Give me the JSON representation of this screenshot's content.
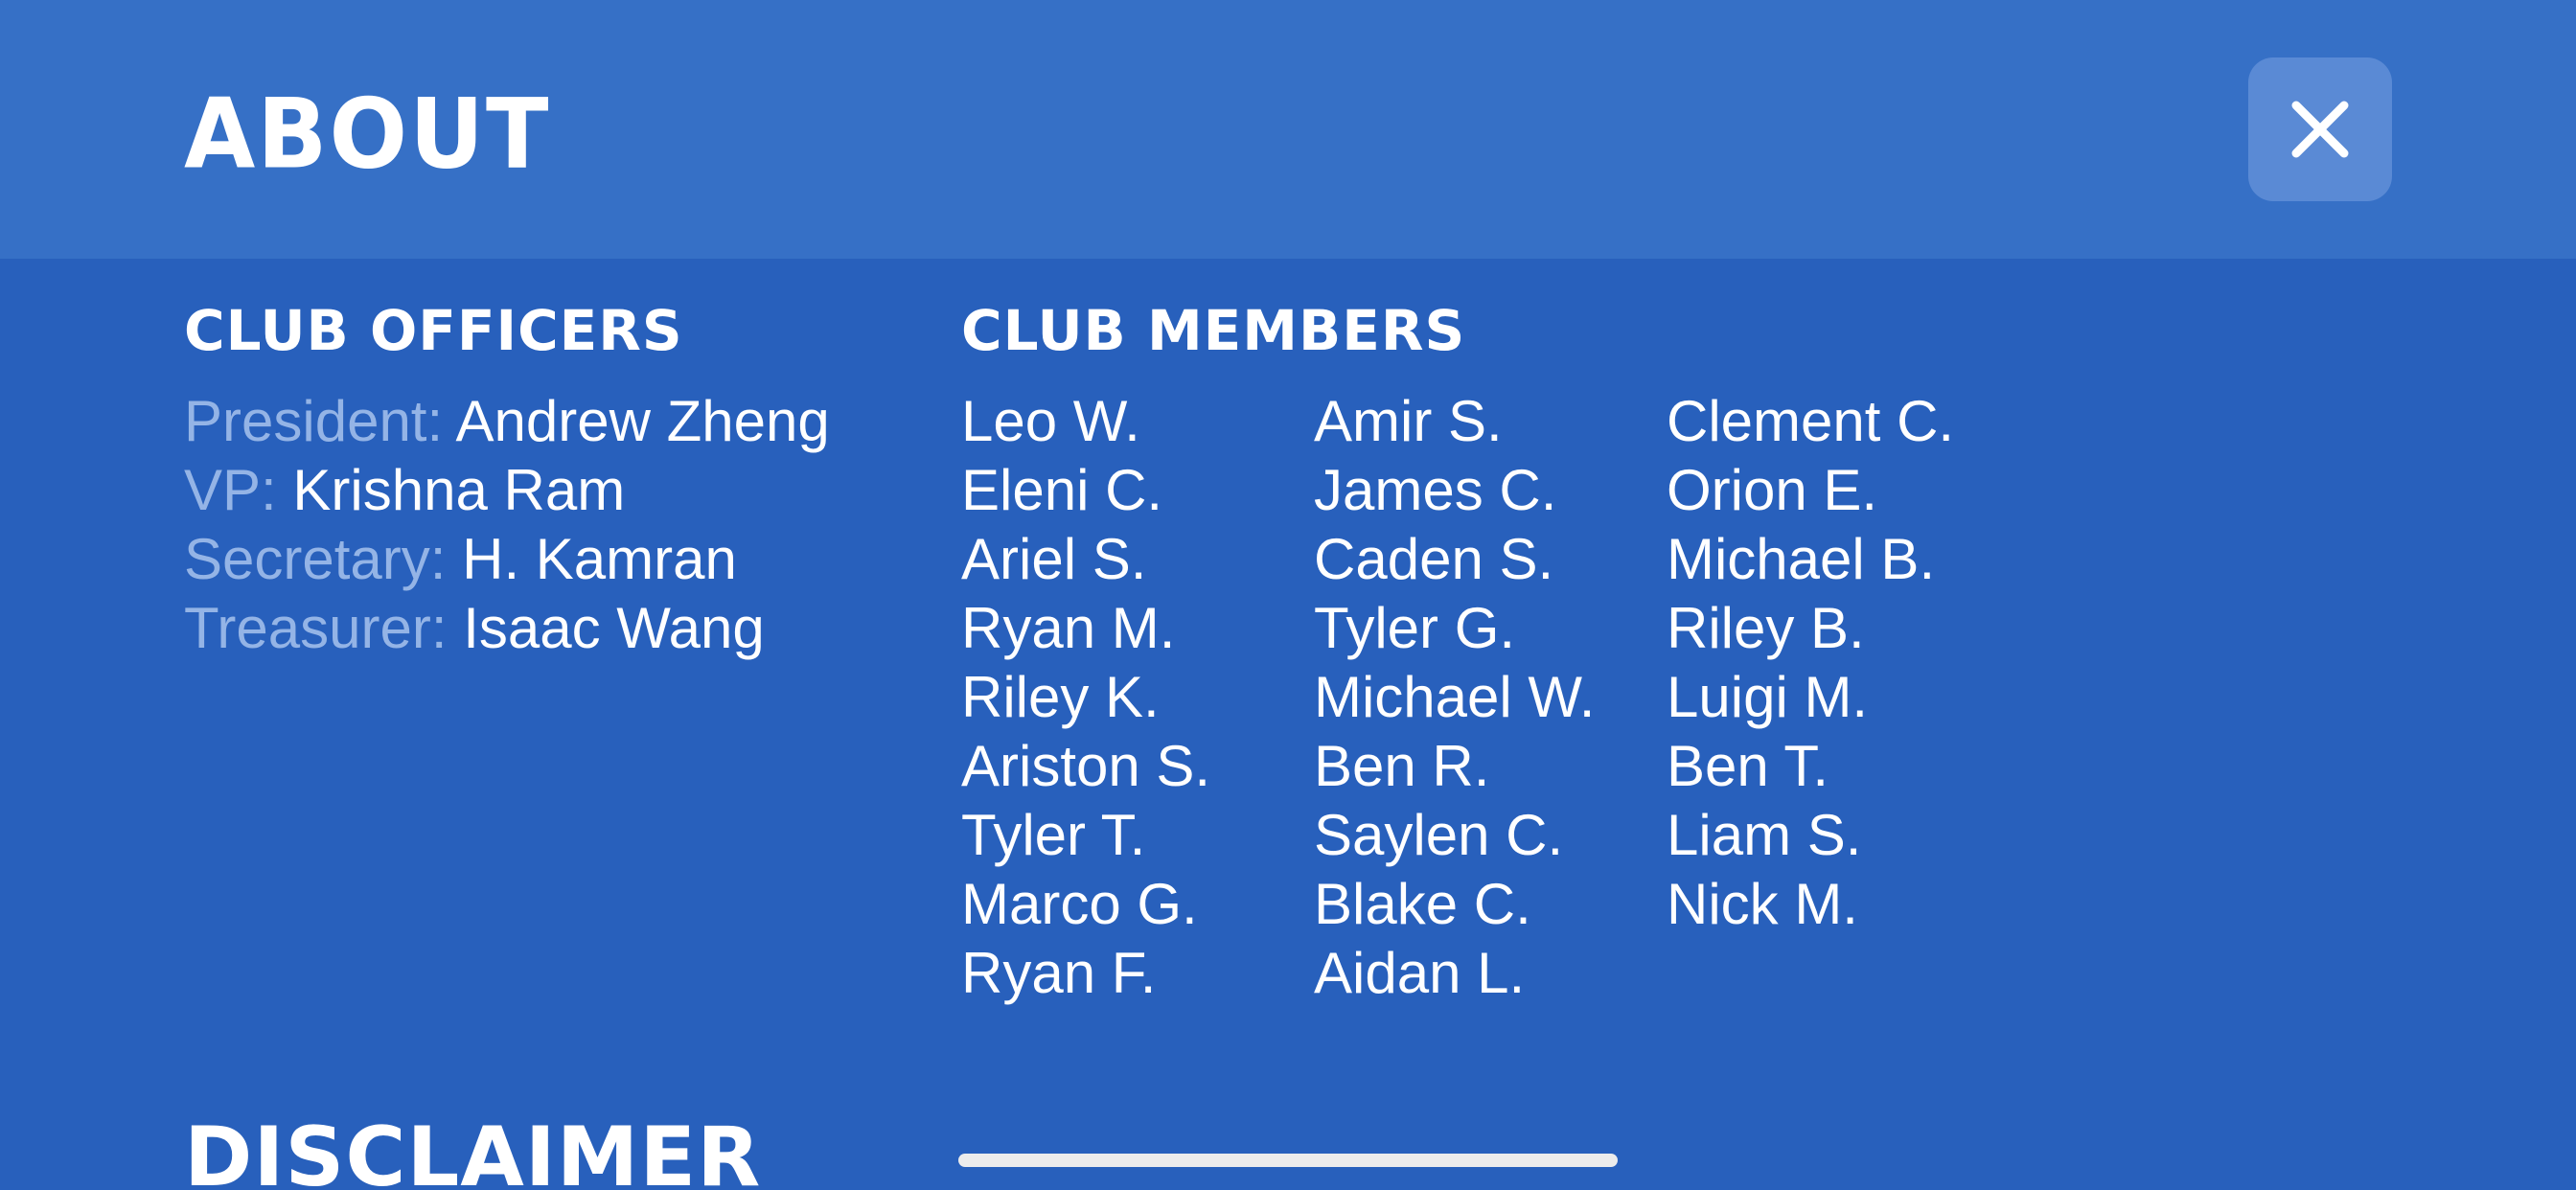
{
  "header": {
    "title": "ABOUT",
    "close_icon": "close-icon"
  },
  "officers": {
    "heading": "CLUB OFFICERS",
    "rows": [
      {
        "role": "President:",
        "name": "Andrew Zheng"
      },
      {
        "role": "VP:",
        "name": "Krishna Ram"
      },
      {
        "role": "Secretary:",
        "name": "H. Kamran"
      },
      {
        "role": "Treasurer:",
        "name": "Isaac Wang"
      }
    ]
  },
  "members": {
    "heading": "CLUB MEMBERS",
    "columns": [
      [
        "Leo W.",
        "Eleni C.",
        "Ariel S.",
        "Ryan M.",
        "Riley K.",
        "Ariston S.",
        "Tyler T.",
        "Marco G.",
        "Ryan F."
      ],
      [
        "Amir S.",
        "James C.",
        "Caden S.",
        "Tyler G.",
        "Michael W.",
        "Ben R.",
        "Saylen C.",
        "Blake C.",
        "Aidan L."
      ],
      [
        "Clement C.",
        "Orion E.",
        "Michael B.",
        "Riley B.",
        "Luigi M.",
        "Ben T.",
        "Liam S.",
        "Nick M."
      ]
    ]
  },
  "disclaimer": {
    "heading": "DISCLAIMER"
  },
  "colors": {
    "background": "#2860bc",
    "header_background": "#3670c6",
    "close_button": "#5a8ad5",
    "role_label": "#94b4e6",
    "text": "#ffffff"
  }
}
